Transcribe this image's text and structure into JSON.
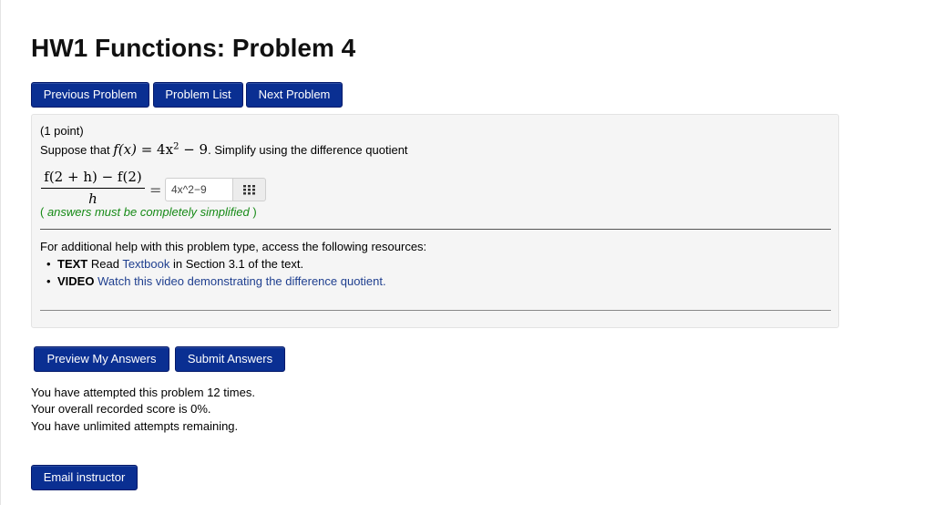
{
  "page": {
    "title": "HW1 Functions: Problem 4"
  },
  "nav": {
    "previous": "Previous Problem",
    "list": "Problem List",
    "next": "Next Problem"
  },
  "problem": {
    "points": "(1 point)",
    "statement_prefix": "Suppose that ",
    "function_lhs": "f(x)",
    "function_eq": " = 4x",
    "function_exp": "2",
    "function_rest": " − 9",
    "statement_suffix": ". Simplify using the difference quotient",
    "quotient_numerator": "f(2 + h) − f(2)",
    "quotient_denominator": "h",
    "equals": "=",
    "answer_value": "4x^2−9",
    "hint": "( answers must be completely simplified )",
    "hint_italic": "answers must be completely simplified",
    "help_intro": "For additional help with this problem type, access the following resources:",
    "resources": [
      {
        "type": "TEXT",
        "verb": "Read",
        "link": "Textbook",
        "tail": "in Section 3.1 of the text."
      },
      {
        "type": "VIDEO",
        "verb": "",
        "link": "Watch this video demonstrating the difference quotient.",
        "tail": ""
      }
    ]
  },
  "actions": {
    "preview": "Preview My Answers",
    "submit": "Submit Answers"
  },
  "status": {
    "attempts": "You have attempted this problem 12 times.",
    "score": "Your overall recorded score is 0%.",
    "remaining": "You have unlimited attempts remaining."
  },
  "footer": {
    "email": "Email instructor"
  },
  "icons": {
    "answer_grid": "grid-icon"
  },
  "colors": {
    "button": "#0a2f92",
    "hint": "#168a16",
    "link": "#1f3f8f"
  }
}
